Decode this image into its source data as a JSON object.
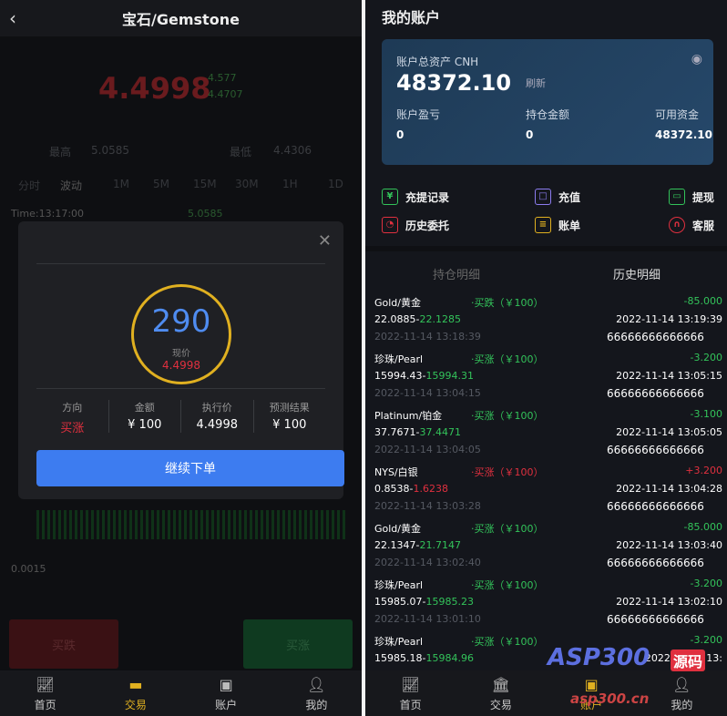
{
  "left": {
    "title": "宝石/Gemstone",
    "back_icon": "chevron-left-icon",
    "price_main": "4.4998",
    "price_sub": [
      "4.577",
      "4.4707"
    ],
    "hi_label": "最高",
    "hi_value": "5.0585",
    "lo_label": "最低",
    "lo_value": "4.4306",
    "periods": [
      "分时",
      "波动",
      "1M",
      "5M",
      "15M",
      "30M",
      "1H",
      "1D"
    ],
    "time_label": "Time:13:17:00",
    "time_value": "5.0585",
    "axis_label": "0.0015",
    "modal": {
      "countdown": "290",
      "current_label": "现价",
      "current_value": "4.4998",
      "info": [
        {
          "key": "方向",
          "value": "买涨",
          "color": "red"
        },
        {
          "key": "金额",
          "value": "¥ 100",
          "color": "white"
        },
        {
          "key": "执行价",
          "value": "4.4998",
          "color": "white"
        },
        {
          "key": "预测结果",
          "value": "¥ 100",
          "color": "white"
        }
      ],
      "continue_label": "继续下单"
    },
    "sell_label": "买跌",
    "buy_label": "买涨",
    "nav": [
      {
        "label": "首页",
        "icon": "chart-icon",
        "active": false
      },
      {
        "label": "交易",
        "icon": "card-icon",
        "active": true
      },
      {
        "label": "账户",
        "icon": "wallet-icon",
        "active": false
      },
      {
        "label": "我的",
        "icon": "user-icon",
        "active": false
      }
    ]
  },
  "right": {
    "title": "我的账户",
    "card": {
      "total_label": "账户总资产 CNH",
      "total_value": "48372.10",
      "refresh_label": "刷新",
      "pnl_label": "账户盈亏",
      "pnl_value": "0",
      "hold_label": "持仓金额",
      "hold_value": "0",
      "avail_label": "可用资金",
      "avail_value": "48372.10"
    },
    "actions": [
      {
        "label": "充提记录",
        "icon": "record-icon",
        "color": "#33c35a"
      },
      {
        "label": "充值",
        "icon": "deposit-icon",
        "color": "#8c7cf0"
      },
      {
        "label": "提现",
        "icon": "withdraw-icon",
        "color": "#33c35a"
      },
      {
        "label": "历史委托",
        "icon": "history-icon",
        "color": "#e0303f"
      },
      {
        "label": "账单",
        "icon": "bill-icon",
        "color": "#e0b020"
      },
      {
        "label": "客服",
        "icon": "service-icon",
        "color": "#e0303f"
      }
    ],
    "tabs": [
      "持仓明细",
      "历史明细"
    ],
    "trades": [
      {
        "name": "Gold/黄金",
        "dir": "·买跌（￥100）",
        "dir_color": "green",
        "pnl": "-85.000",
        "pnl_color": "green",
        "open_price": "22.0885-",
        "close_price": "22.1285",
        "close_color": "green",
        "close_time": "2022-11-14 13:19:39",
        "open_time": "2022-11-14 13:18:39",
        "order_id": "66666666666666"
      },
      {
        "name": "珍珠/Pearl",
        "dir": "·买涨（￥100）",
        "dir_color": "green",
        "pnl": "-3.200",
        "pnl_color": "green",
        "open_price": "15994.43-",
        "close_price": "15994.31",
        "close_color": "green",
        "close_time": "2022-11-14 13:05:15",
        "open_time": "2022-11-14 13:04:15",
        "order_id": "66666666666666"
      },
      {
        "name": "Platinum/铂金",
        "dir": "·买涨（￥100）",
        "dir_color": "green",
        "pnl": "-3.100",
        "pnl_color": "green",
        "open_price": "37.7671-",
        "close_price": "37.4471",
        "close_color": "green",
        "close_time": "2022-11-14 13:05:05",
        "open_time": "2022-11-14 13:04:05",
        "order_id": "66666666666666"
      },
      {
        "name": "NYS/白银",
        "dir": "·买涨（￥100）",
        "dir_color": "red",
        "pnl": "+3.200",
        "pnl_color": "red",
        "open_price": "0.8538-",
        "close_price": "1.6238",
        "close_color": "red",
        "close_time": "2022-11-14 13:04:28",
        "open_time": "2022-11-14 13:03:28",
        "order_id": "66666666666666"
      },
      {
        "name": "Gold/黄金",
        "dir": "·买涨（￥100）",
        "dir_color": "green",
        "pnl": "-85.000",
        "pnl_color": "green",
        "open_price": "22.1347-",
        "close_price": "21.7147",
        "close_color": "green",
        "close_time": "2022-11-14 13:03:40",
        "open_time": "2022-11-14 13:02:40",
        "order_id": "66666666666666"
      },
      {
        "name": "珍珠/Pearl",
        "dir": "·买涨（￥100）",
        "dir_color": "green",
        "pnl": "-3.200",
        "pnl_color": "green",
        "open_price": "15985.07-",
        "close_price": "15985.23",
        "close_color": "green",
        "close_time": "2022-11-14 13:02:10",
        "open_time": "2022-11-14 13:01:10",
        "order_id": "66666666666666"
      },
      {
        "name": "珍珠/Pearl",
        "dir": "·买涨（￥100）",
        "dir_color": "green",
        "pnl": "-3.200",
        "pnl_color": "green",
        "open_price": "15985.18-",
        "close_price": "15984.96",
        "close_color": "green",
        "close_time": "2022-11-14 13:",
        "open_time": "",
        "order_id": ""
      }
    ],
    "nav": [
      {
        "label": "首页",
        "icon": "chart-icon",
        "active": false
      },
      {
        "label": "交易",
        "icon": "bank-icon",
        "active": false
      },
      {
        "label": "账户",
        "icon": "wallet-icon",
        "active": true
      },
      {
        "label": "我的",
        "icon": "user-icon",
        "active": false
      }
    ],
    "watermark": "ASP300",
    "watermark_tag": "源码",
    "watermark_url": "asp300.cn"
  },
  "colors": {
    "accent_blue": "#3d7cf0",
    "gold": "#e0b020",
    "up_green": "#33c35a",
    "down_red": "#e0303f"
  }
}
